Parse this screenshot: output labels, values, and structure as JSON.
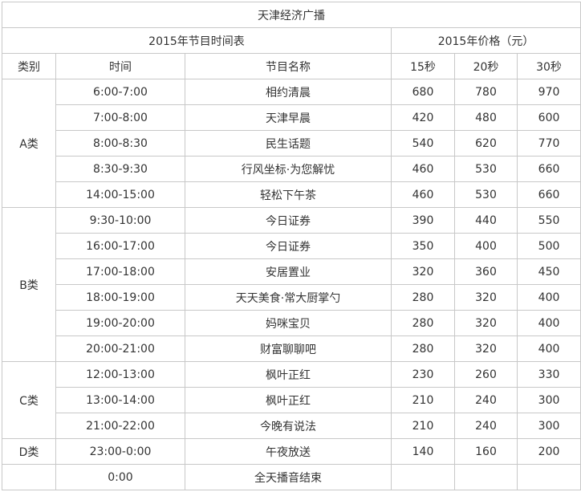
{
  "title": "天津经济广播",
  "group_headers": {
    "schedule": "2015年节目时间表",
    "price": "2015年价格（元）"
  },
  "column_headers": [
    "类别",
    "时间",
    "节目名称",
    "15秒",
    "20秒",
    "30秒"
  ],
  "categories": [
    {
      "name": "A类",
      "rows": [
        {
          "time": "6:00-7:00",
          "program": "相约清晨",
          "p15": "680",
          "p20": "780",
          "p30": "970"
        },
        {
          "time": "7:00-8:00",
          "program": "天津早晨",
          "p15": "420",
          "p20": "480",
          "p30": "600"
        },
        {
          "time": "8:00-8:30",
          "program": "民生话题",
          "p15": "540",
          "p20": "620",
          "p30": "770"
        },
        {
          "time": "8:30-9:30",
          "program": "行风坐标·为您解忧",
          "p15": "460",
          "p20": "530",
          "p30": "660"
        },
        {
          "time": "14:00-15:00",
          "program": "轻松下午茶",
          "p15": "460",
          "p20": "530",
          "p30": "660"
        }
      ]
    },
    {
      "name": "B类",
      "rows": [
        {
          "time": "9:30-10:00",
          "program": "今日证券",
          "p15": "390",
          "p20": "440",
          "p30": "550"
        },
        {
          "time": "16:00-17:00",
          "program": "今日证券",
          "p15": "350",
          "p20": "400",
          "p30": "500"
        },
        {
          "time": "17:00-18:00",
          "program": "安居置业",
          "p15": "320",
          "p20": "360",
          "p30": "450"
        },
        {
          "time": "18:00-19:00",
          "program": "天天美食·常大厨掌勺",
          "p15": "280",
          "p20": "320",
          "p30": "400"
        },
        {
          "time": "19:00-20:00",
          "program": "妈咪宝贝",
          "p15": "280",
          "p20": "320",
          "p30": "400"
        },
        {
          "time": "20:00-21:00",
          "program": "财富聊聊吧",
          "p15": "280",
          "p20": "320",
          "p30": "400"
        }
      ]
    },
    {
      "name": "C类",
      "rows": [
        {
          "time": "12:00-13:00",
          "program": "枫叶正红",
          "p15": "230",
          "p20": "260",
          "p30": "330"
        },
        {
          "time": "13:00-14:00",
          "program": "枫叶正红",
          "p15": "210",
          "p20": "240",
          "p30": "300"
        },
        {
          "time": "21:00-22:00",
          "program": "今晚有说法",
          "p15": "210",
          "p20": "240",
          "p30": "300"
        }
      ]
    },
    {
      "name": "D类",
      "rows": [
        {
          "time": "23:00-0:00",
          "program": "午夜放送",
          "p15": "140",
          "p20": "160",
          "p30": "200"
        }
      ]
    }
  ],
  "final_row": {
    "time": "0:00",
    "program": "全天播音结束"
  }
}
